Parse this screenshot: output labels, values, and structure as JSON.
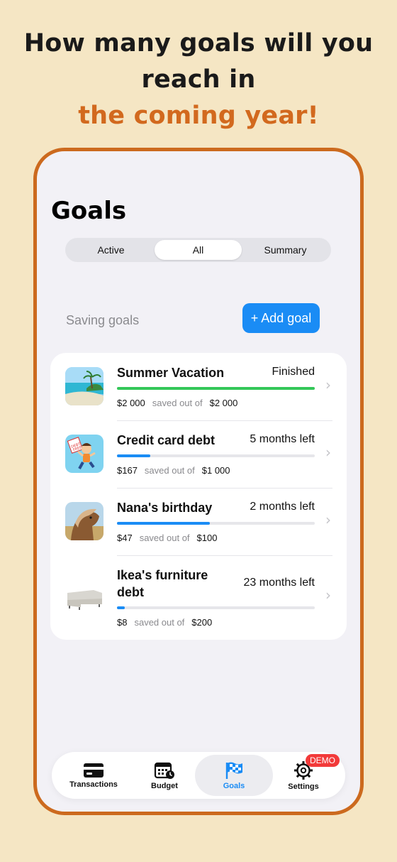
{
  "headline": {
    "line1": "How many goals will you",
    "line2": "reach in",
    "line3": "the coming year!"
  },
  "page": {
    "title": "Goals"
  },
  "segments": [
    {
      "label": "Active",
      "selected": false
    },
    {
      "label": "All",
      "selected": true
    },
    {
      "label": "Summary",
      "selected": false
    }
  ],
  "section": {
    "label": "Saving goals",
    "add_button": "+ Add goal"
  },
  "goals": [
    {
      "name": "Summer Vacation",
      "status": "Finished",
      "saved": "$2 000",
      "saved_label": "saved out of",
      "target": "$2 000",
      "progress": 1.0,
      "bar_color": "#34c759",
      "image": "beach-photo"
    },
    {
      "name": "Credit card debt",
      "status": "5 months left",
      "saved": "$167",
      "saved_label": "saved out of",
      "target": "$1 000",
      "progress": 0.167,
      "bar_color": "#1a8cf5",
      "image": "debt-free-illustration"
    },
    {
      "name": "Nana's birthday",
      "status": "2 months left",
      "saved": "$47",
      "saved_label": "saved out of",
      "target": "$100",
      "progress": 0.47,
      "bar_color": "#1a8cf5",
      "image": "horse-photo"
    },
    {
      "name": "Ikea's furniture debt",
      "status": "23 months left",
      "saved": "$8",
      "saved_label": "saved out of",
      "target": "$200",
      "progress": 0.04,
      "bar_color": "#1a8cf5",
      "image": "sofa-photo"
    }
  ],
  "tabbar": {
    "items": [
      {
        "label": "Transactions",
        "icon": "credit-card-icon",
        "active": false
      },
      {
        "label": "Budget",
        "icon": "calendar-clock-icon",
        "active": false
      },
      {
        "label": "Goals",
        "icon": "checkered-flag-icon",
        "active": true
      },
      {
        "label": "Settings",
        "icon": "gear-icon",
        "active": false
      }
    ],
    "badge": "DEMO"
  },
  "colors": {
    "accent": "#1a8cf5",
    "brand_orange": "#cc6a1e",
    "background": "#f5e6c4",
    "success": "#34c759",
    "badge": "#f23a3a"
  }
}
